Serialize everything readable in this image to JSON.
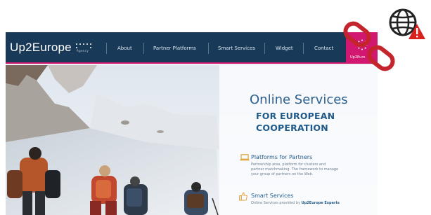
{
  "site": {
    "logo_text": "Up2Europe",
    "logo_sub": "Agency"
  },
  "nav": {
    "items": [
      {
        "label": "About"
      },
      {
        "label": "Partner Platforms"
      },
      {
        "label": "Smart Services"
      },
      {
        "label": "Widget"
      },
      {
        "label": "Contact"
      }
    ],
    "active_label": "Up2Euro"
  },
  "hero": {
    "title_line_1": "Online Services",
    "title_line_2": "FOR EUROPEAN",
    "title_line_3": "COOPERATION"
  },
  "features": [
    {
      "icon": "laptop-icon",
      "title": "Platforms for Partners",
      "lines": [
        "Partnership area, platform for clusters and",
        "partner matchmaking. The framework to manage",
        "your group of partners on the Web."
      ]
    },
    {
      "icon": "thumbs-up-icon",
      "title": "Smart Services",
      "text_prefix": "Online Services provided by",
      "text_strong": "Up2Europe Experts"
    }
  ],
  "overlay_icons": {
    "globe": "globe-warning-icon",
    "link": "broken-link-icon"
  },
  "colors": {
    "nav_bg": "#183a58",
    "accent_pink": "#d1176f",
    "title_blue": "#1f5a8a",
    "warning_red": "#d9211e",
    "chain_red": "#c4242b"
  }
}
